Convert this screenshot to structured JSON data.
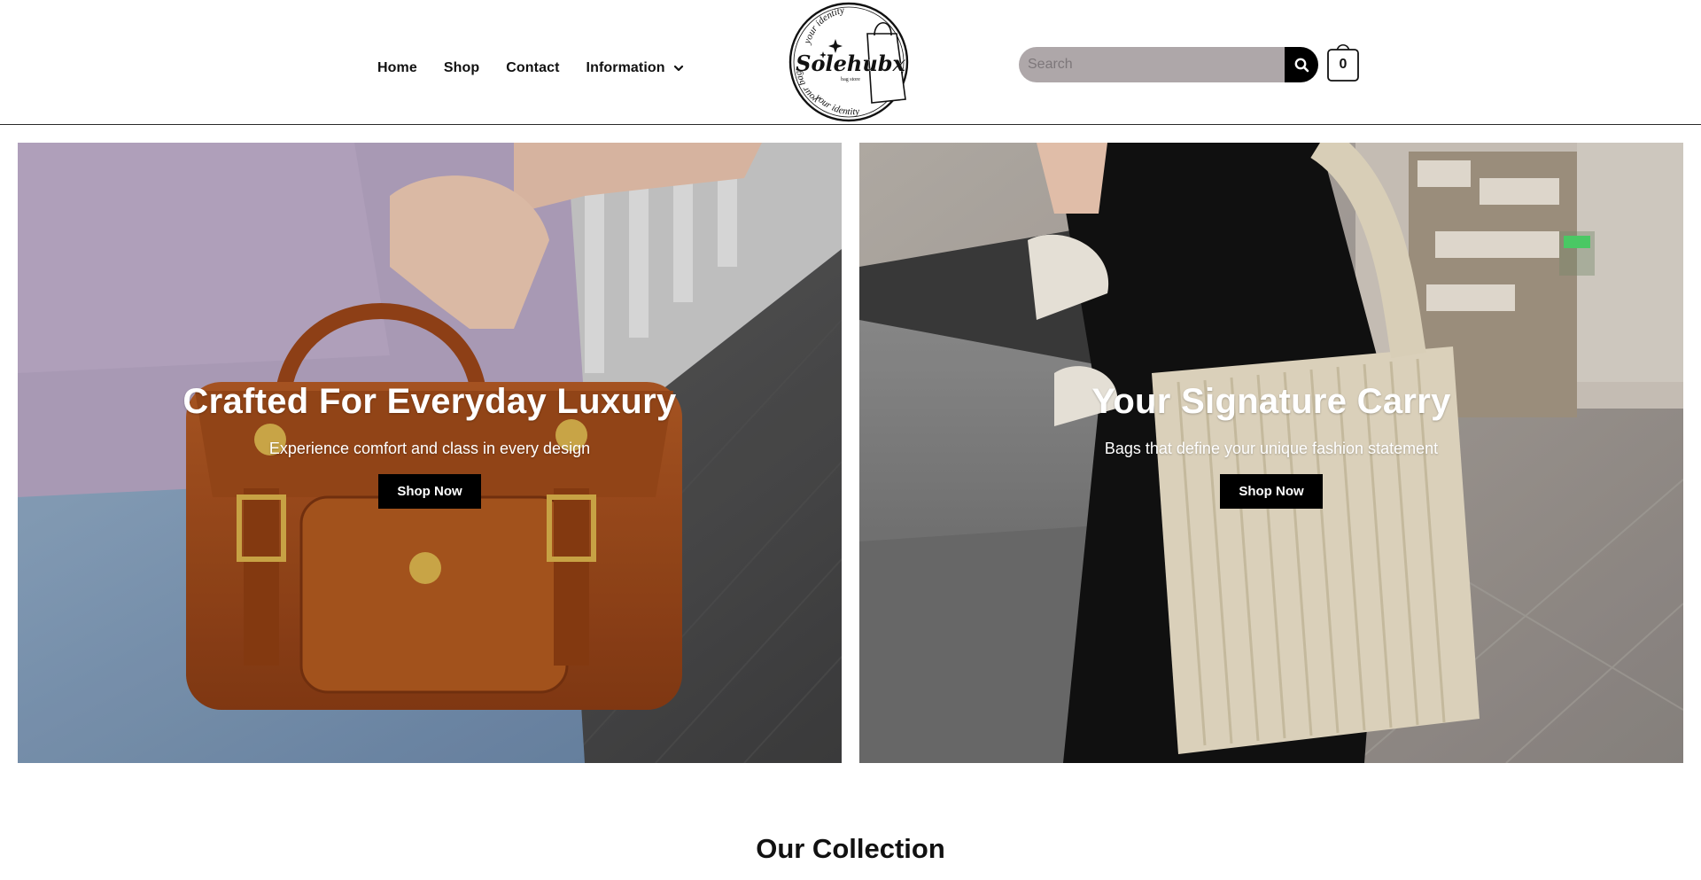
{
  "header": {
    "nav": {
      "home": "Home",
      "shop": "Shop",
      "contact": "Contact",
      "information": "Information"
    },
    "logo": {
      "brand": "Solehubx",
      "top_arc": "your identity",
      "left_arc": "your bag",
      "bottom_arc": "your identity",
      "tagline": "bag store"
    },
    "search": {
      "placeholder": "Search"
    },
    "cart": {
      "count": "0"
    }
  },
  "hero": [
    {
      "title": "Crafted For Everyday Luxury",
      "subtitle": "Experience comfort and class in every design",
      "button": "Shop Now"
    },
    {
      "title": "Your Signature Carry",
      "subtitle": "Bags that define your unique fashion statement",
      "button": "Shop Now"
    }
  ],
  "collection": {
    "title": "Our Collection"
  },
  "icons": {
    "search": "search-icon",
    "cart": "shopping-bag-icon",
    "dropdown": "chevron-down-icon"
  },
  "colors": {
    "search_bg": "#aea7a9",
    "button_bg": "#000000",
    "text": "#111111"
  }
}
